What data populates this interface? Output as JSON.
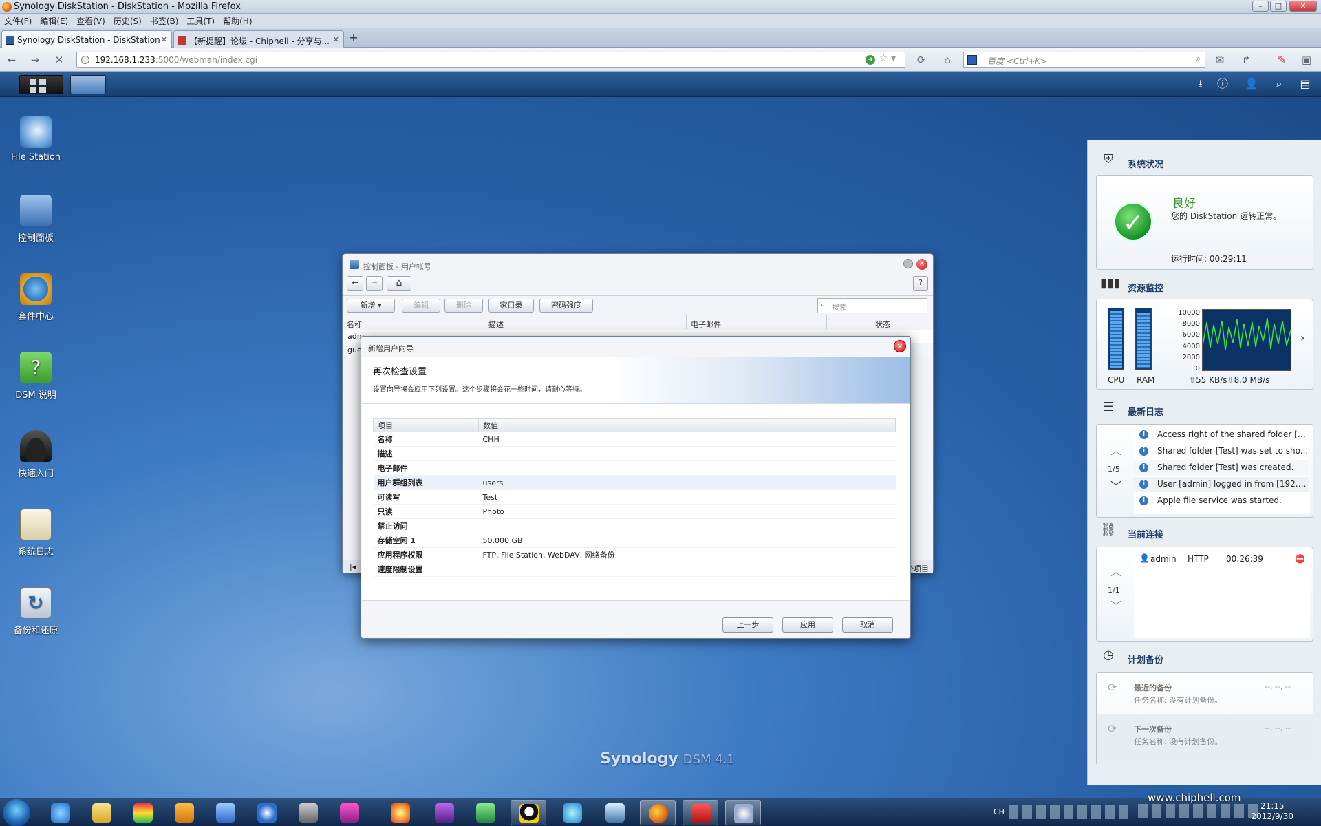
{
  "browser": {
    "window_title": "Synology DiskStation - DiskStation - Mozilla Firefox",
    "menu": [
      "文件(F)",
      "编辑(E)",
      "查看(V)",
      "历史(S)",
      "书签(B)",
      "工具(T)",
      "帮助(H)"
    ],
    "tabs": [
      {
        "label": "Synology DiskStation - DiskStation",
        "active": true
      },
      {
        "label": "【新提醒】论坛 - Chiphell - 分享与...",
        "active": false
      }
    ],
    "url_host": "192.168.1.233",
    "url_rest": ":5000/webman/index.cgi",
    "search_placeholder": "百度 <Ctrl+K>"
  },
  "desktop_icons": [
    {
      "label": "File Station",
      "icon": "file-station-icon",
      "color": "#6aa3dc"
    },
    {
      "label": "控制面板",
      "icon": "control-panel-icon",
      "color": "#3a6fb0"
    },
    {
      "label": "套件中心",
      "icon": "package-center-icon",
      "color": "#e7a52b"
    },
    {
      "label": "DSM 说明",
      "icon": "help-icon",
      "color": "#4aae3a"
    },
    {
      "label": "快速入门",
      "icon": "quick-start-icon",
      "color": "#333333"
    },
    {
      "label": "系统日志",
      "icon": "system-log-icon",
      "color": "#e9e4cf"
    },
    {
      "label": "备份和还原",
      "icon": "backup-restore-icon",
      "color": "#dfe6ee"
    }
  ],
  "brand": {
    "name": "Synology",
    "product": "DSM 4.1"
  },
  "control_panel": {
    "title": "控制面板 - 用户帐号",
    "toolbar": {
      "new": "新增",
      "edit": "编辑",
      "delete": "删除",
      "home": "家目录",
      "password": "密码强度"
    },
    "search_placeholder": "搜索",
    "columns": [
      "名称",
      "描述",
      "电子邮件",
      "状态"
    ],
    "rows": [
      "adm",
      "gue"
    ],
    "footer": "个项目"
  },
  "wizard": {
    "title": "新增用户向导",
    "heading": "再次检查设置",
    "description": "设置向导将会应用下列设置。这个步骤将会花一些时间，请耐心等待。",
    "columns": {
      "item": "项目",
      "value": "数值"
    },
    "rows": [
      {
        "key": "名称",
        "value": "CHH"
      },
      {
        "key": "描述",
        "value": ""
      },
      {
        "key": "电子邮件",
        "value": ""
      },
      {
        "key": "用户群组列表",
        "value": "users"
      },
      {
        "key": "可读写",
        "value": "Test"
      },
      {
        "key": "只读",
        "value": "Photo"
      },
      {
        "key": "禁止访问",
        "value": ""
      },
      {
        "key": "存储空间 1",
        "value": "50.000 GB"
      },
      {
        "key": "应用程序权限",
        "value": "FTP, File Station, WebDAV, 网络备份"
      },
      {
        "key": "速度限制设置",
        "value": ""
      }
    ],
    "buttons": {
      "back": "上一步",
      "apply": "应用",
      "cancel": "取消"
    }
  },
  "widgets": {
    "system_status": {
      "title": "系统状况",
      "state": "良好",
      "message": "您的 DiskStation 运转正常。",
      "uptime": "运行时间: 00:29:11",
      "state_color": "#3a9a2a"
    },
    "resource_monitor": {
      "title": "资源监控",
      "cpu_label": "CPU",
      "ram_label": "RAM",
      "cpu_level": 0.95,
      "ram_level": 0.92,
      "y_ticks": [
        "10000",
        "8000",
        "6000",
        "4000",
        "2000",
        "0"
      ],
      "upload": "55 KB/s",
      "download": "8.0 MB/s"
    },
    "recent_logs": {
      "title": "最新日志",
      "page": "1/5",
      "items": [
        "Access right of the shared folder [T...",
        "Shared folder [Test] was set to sho...",
        "Shared folder [Test] was created.",
        "User [admin] logged in from [192.1...",
        "Apple file service was started."
      ]
    },
    "connections": {
      "title": "当前连接",
      "page": "1/1",
      "user": "admin",
      "protocol": "HTTP",
      "time": "00:26:39"
    },
    "scheduled_backup": {
      "title": "计划备份",
      "last_label": "最近的备份",
      "last_task": "任务名称: 没有计划备份。",
      "next_label": "下一次备份",
      "next_task": "任务名称: 没有计划备份。",
      "placeholder": "--, --, --"
    }
  },
  "os_taskbar": {
    "lang": "CH",
    "time": "21:15",
    "date": "2012/9/30",
    "watermark": "www.chiphell.com"
  }
}
